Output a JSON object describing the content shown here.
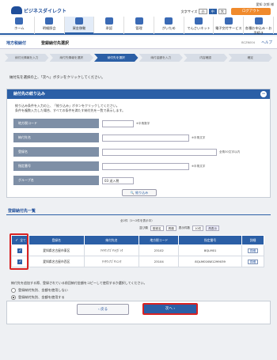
{
  "header": {
    "logo": "ビジネスダイレクト",
    "user": "愛知 次郎 様",
    "font_label": "文字サイズ",
    "font_sizes": [
      "小",
      "中",
      "大"
    ],
    "logout": "ログアウト"
  },
  "nav": [
    "ホーム",
    "明細照会",
    "資金移動",
    "承認",
    "管理",
    "がいため",
    "でんさいネット",
    "電子交付サービス",
    "各種お申込み・お手続き"
  ],
  "title": {
    "section": "地方税納付",
    "page": "登録納付先選択",
    "code": "BCZN004",
    "help": "ヘルプ"
  },
  "steps": [
    "納付元情報を入力",
    "納付先情報を選択",
    "納付先を選択",
    "納付金額を入力",
    "内容確認",
    "確定"
  ],
  "instruction": "納付先を選択の上、「次へ」ボタンをクリックしてください。",
  "search": {
    "title": "納付先の絞り込み",
    "desc1": "絞り込み条件を入力の上、「絞り込み」ボタンをクリックしてください。",
    "desc2": "条件を複数入力した場合、すべての条件を満たす納付先を一覧で表示します。",
    "fields": [
      {
        "label": "地方税コード",
        "value": "",
        "hint": "※半角数字"
      },
      {
        "label": "納付先名",
        "value": "",
        "hint": "※半角文字"
      },
      {
        "label": "登録名",
        "value": "",
        "hint": "全角30文字以内"
      },
      {
        "label": "指定番号",
        "value": "",
        "hint": "※半角文字"
      },
      {
        "label": "グループ名",
        "value": "03 送入税",
        "hint": ""
      }
    ],
    "button": "絞り込み"
  },
  "list": {
    "title": "登録納付先一覧",
    "count": "全2件（1〜2件を表示中）",
    "sort_label": "並び順",
    "sort_value": "登録名",
    "order": "昇順",
    "per_page_label": "表示件数",
    "per_page": "10件",
    "redisplay": "再表示",
    "headers": [
      "全て",
      "登録名",
      "納付先名",
      "地方税コード",
      "指定番号",
      "詳細"
    ],
    "rows": [
      {
        "name": "愛知県名古屋市東区",
        "payee": "ｱｲﾁｹﾝﾅｺﾞﾔｼﾋｶﾞｼｸ",
        "code": "23102",
        "number": "8QLM01",
        "detail": "詳細"
      },
      {
        "name": "愛知県名古屋市西区",
        "payee": "ｱｲﾁｹﾝﾅｺﾞﾔｼﾆｼｸ",
        "code": "23104",
        "number": "8QLM01KW1299039",
        "detail": "詳細"
      }
    ]
  },
  "note": "納付先を追加する際、登録されている前回納付金額をコピーして使用するか選択してください。",
  "radios": [
    {
      "label": "登録納付先別、金額を使用しない",
      "checked": false
    },
    {
      "label": "登録納付先別、金額を使用する",
      "checked": true
    }
  ],
  "buttons": {
    "back": "戻る",
    "next": "次へ"
  }
}
